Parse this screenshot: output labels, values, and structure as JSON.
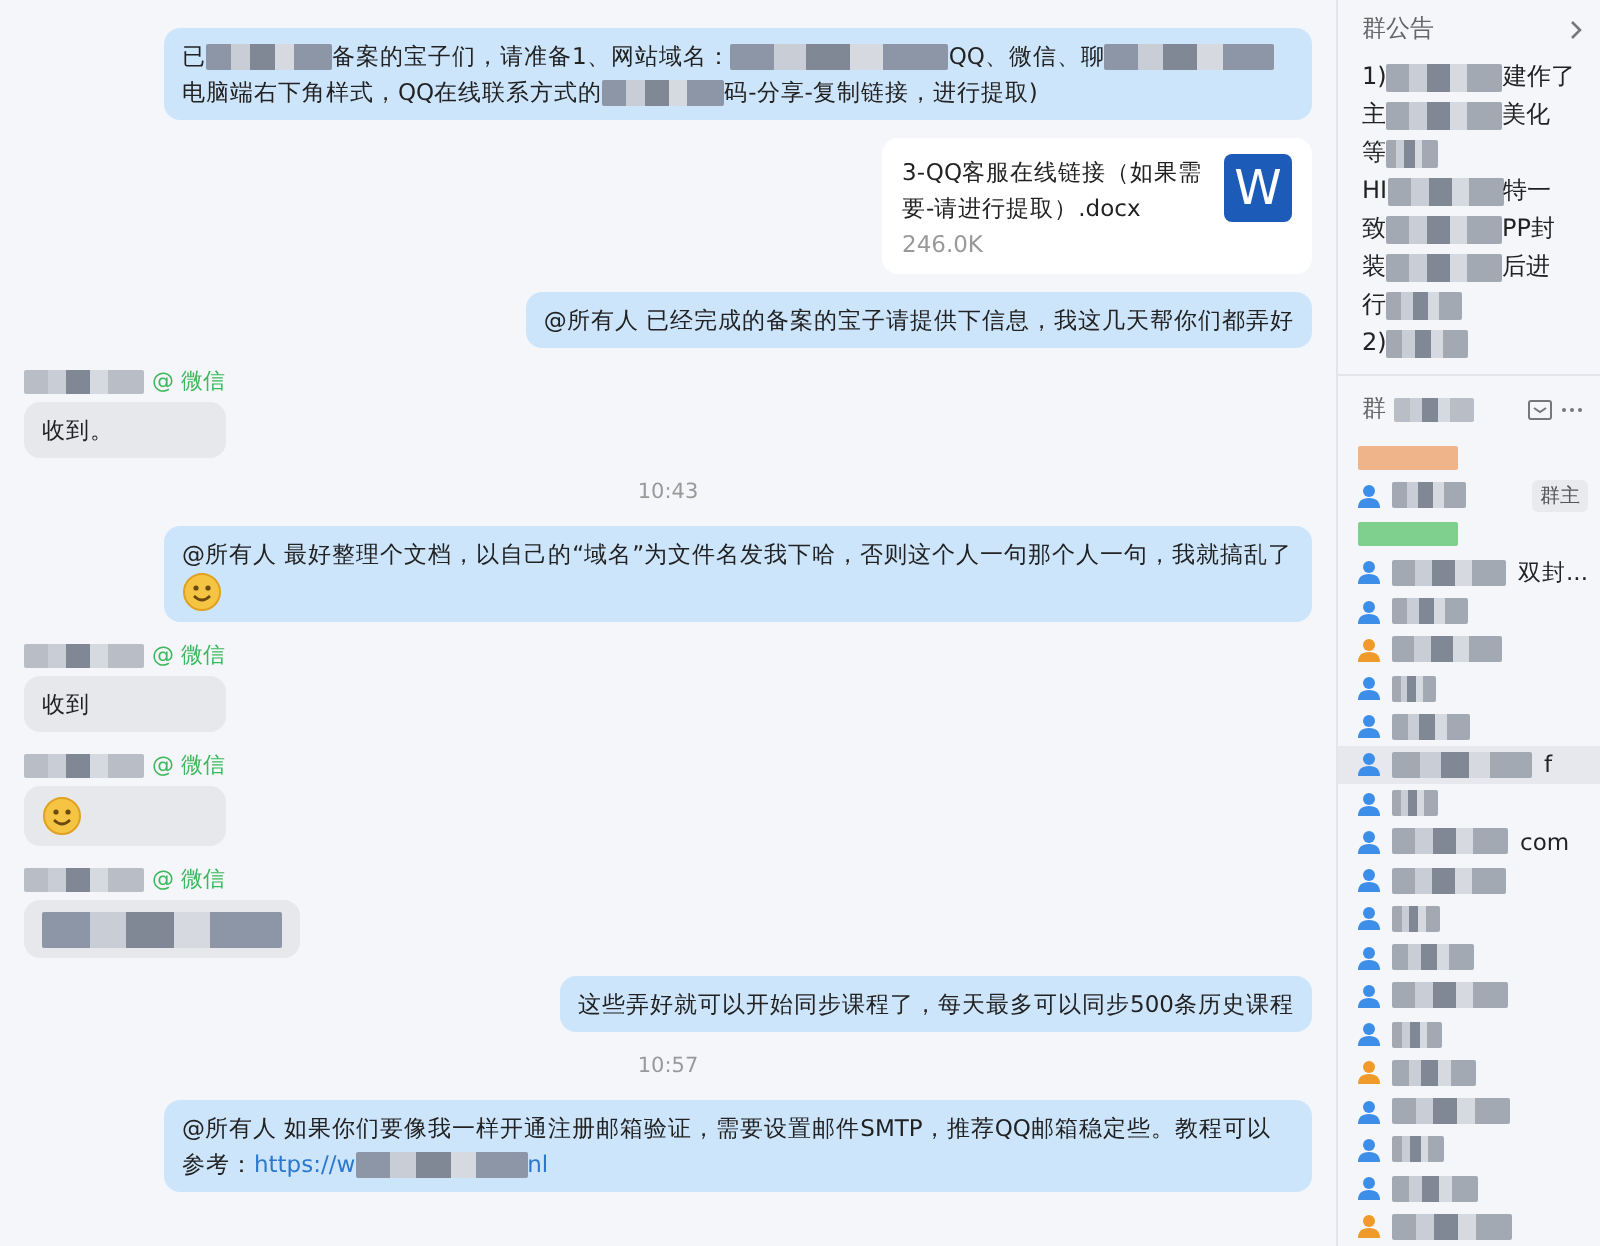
{
  "chat": {
    "items": [
      {
        "kind": "out",
        "parts": [
          {
            "kind": "text",
            "text": "已"
          },
          {
            "kind": "blur"
          },
          {
            "kind": "text",
            "text": "备案的宝子们，请准备1、网站域名："
          },
          {
            "kind": "blur"
          },
          {
            "kind": "text",
            "text": "QQ、微信、聊"
          },
          {
            "kind": "blur"
          },
          {
            "kind": "text",
            "text": "电脑端右下角样式，QQ在线联系方式的"
          },
          {
            "kind": "blur"
          },
          {
            "kind": "text",
            "text": "码-分享-复制链接，进行提取)"
          }
        ]
      },
      {
        "kind": "file",
        "name": "3-QQ客服在线链接（如果需要-请进行提取）.docx",
        "size": "246.0K",
        "icon": "W"
      },
      {
        "kind": "out",
        "parts": [
          {
            "kind": "text",
            "text": "@所有人  已经完成的备案的宝子请提供下信息，我这几天帮你们都弄好"
          }
        ]
      },
      {
        "kind": "in",
        "via": "@ 微信",
        "parts": [
          {
            "kind": "text",
            "text": "收到。"
          }
        ]
      },
      {
        "kind": "time",
        "text": "10:43"
      },
      {
        "kind": "out",
        "parts": [
          {
            "kind": "text",
            "text": "@所有人  最好整理个文档，以自己的“域名”为文件名发我下哈，否则这个人一句那个人一句，我就搞乱了"
          },
          {
            "kind": "emoji"
          }
        ]
      },
      {
        "kind": "in",
        "via": "@ 微信",
        "parts": [
          {
            "kind": "text",
            "text": "收到"
          }
        ]
      },
      {
        "kind": "in",
        "via": "@ 微信",
        "parts": [
          {
            "kind": "emoji"
          }
        ]
      },
      {
        "kind": "in",
        "via": "@ 微信",
        "parts": [
          {
            "kind": "blur"
          }
        ]
      },
      {
        "kind": "out",
        "parts": [
          {
            "kind": "text",
            "text": "这些弄好就可以开始同步课程了，每天最多可以同步500条历史课程"
          }
        ]
      },
      {
        "kind": "time",
        "text": "10:57"
      },
      {
        "kind": "out",
        "parts": [
          {
            "kind": "text",
            "text": "@所有人  如果你们要像我一样开通注册邮箱验证，需要设置邮件SMTP，推荐QQ邮箱稳定些。教程可以参考："
          },
          {
            "kind": "link",
            "text": "https://w"
          },
          {
            "kind": "blur"
          },
          {
            "kind": "link",
            "text": "nl"
          }
        ]
      }
    ]
  },
  "sidebar": {
    "notice_title": "群公告",
    "notice_lines": [
      {
        "start": "1)",
        "end": "建作了"
      },
      {
        "start": "主",
        "end": "美化"
      },
      {
        "start": "等"
      },
      {
        "start": "HI",
        "end": "特一"
      },
      {
        "start": "致",
        "end": "PP封"
      },
      {
        "start": "装",
        "end": "后进"
      },
      {
        "start": "行"
      },
      {
        "start": "2)"
      }
    ],
    "members_title": "群",
    "members": [
      {
        "kind": "label",
        "color": "#f0b48a",
        "selected": false
      },
      {
        "kind": "member",
        "color": "#3d8ee8",
        "badge": "群主",
        "selected": false
      },
      {
        "kind": "label",
        "color": "#7fd08f",
        "selected": false
      },
      {
        "kind": "member",
        "color": "#3d8ee8",
        "suffix": "双封...",
        "selected": false
      },
      {
        "kind": "member",
        "color": "#3d8ee8",
        "selected": false
      },
      {
        "kind": "member",
        "color": "#f09a2a",
        "selected": false
      },
      {
        "kind": "member",
        "color": "#3d8ee8",
        "selected": false
      },
      {
        "kind": "member",
        "color": "#3d8ee8",
        "selected": false
      },
      {
        "kind": "member",
        "color": "#3d8ee8",
        "suffix": "f",
        "selected": true
      },
      {
        "kind": "member",
        "color": "#3d8ee8",
        "selected": false
      },
      {
        "kind": "member",
        "color": "#3d8ee8",
        "suffix": "com",
        "selected": false
      },
      {
        "kind": "member",
        "color": "#3d8ee8",
        "selected": false
      },
      {
        "kind": "member",
        "color": "#3d8ee8",
        "selected": false
      },
      {
        "kind": "member",
        "color": "#3d8ee8",
        "selected": false
      },
      {
        "kind": "member",
        "color": "#3d8ee8",
        "selected": false
      },
      {
        "kind": "member",
        "color": "#3d8ee8",
        "selected": false
      },
      {
        "kind": "member",
        "color": "#f09a2a",
        "selected": false
      },
      {
        "kind": "member",
        "color": "#3d8ee8",
        "selected": false
      },
      {
        "kind": "member",
        "color": "#3d8ee8",
        "selected": false
      },
      {
        "kind": "member",
        "color": "#3d8ee8",
        "selected": false
      },
      {
        "kind": "member",
        "color": "#f09a2a",
        "selected": false
      }
    ]
  }
}
